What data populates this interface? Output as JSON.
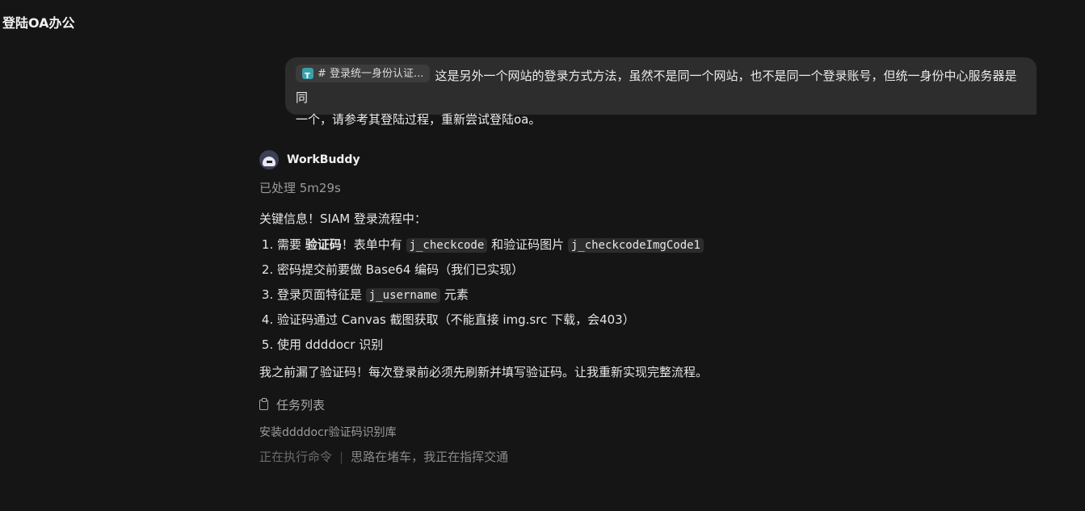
{
  "window": {
    "title": "登陆OA办公"
  },
  "user_message": {
    "ref_chip": "# 登录统一身份认证...",
    "text_line1": "这是另外一个网站的登录方式方法，虽然不是同一个网站，也不是同一个登录账号，但统一身份中心服务器是同",
    "text_line2": "一个，请参考其登陆过程，重新尝试登陆oa。"
  },
  "assistant": {
    "name": "WorkBuddy",
    "processed": "已处理 5m29s",
    "intro": "关键信息！SIAM 登录流程中：",
    "items": {
      "i1": {
        "a": "需要 ",
        "bold": "验证码",
        "b": "！表单中有 ",
        "code1": "j_checkcode",
        "c": " 和验证码图片 ",
        "code2": "j_checkcodeImgCode1"
      },
      "i2": {
        "text": "密码提交前要做 Base64 编码（我们已实现）"
      },
      "i3": {
        "a": "登录页面特征是 ",
        "code": "j_username",
        "b": " 元素"
      },
      "i4": {
        "text": "验证码通过 Canvas 截图获取（不能直接 img.src 下载，会403）"
      },
      "i5": {
        "text": "使用 ddddocr 识别"
      }
    },
    "conclusion": "我之前漏了验证码！每次登录前必须先刷新并填写验证码。让我重新实现完整流程。",
    "task_list_label": "任务列表",
    "task_item": "安装ddddocr验证码识别库",
    "status": "正在执行命令",
    "status_separator": "|",
    "status_message": "思路在堵车，我正在指挥交通"
  }
}
